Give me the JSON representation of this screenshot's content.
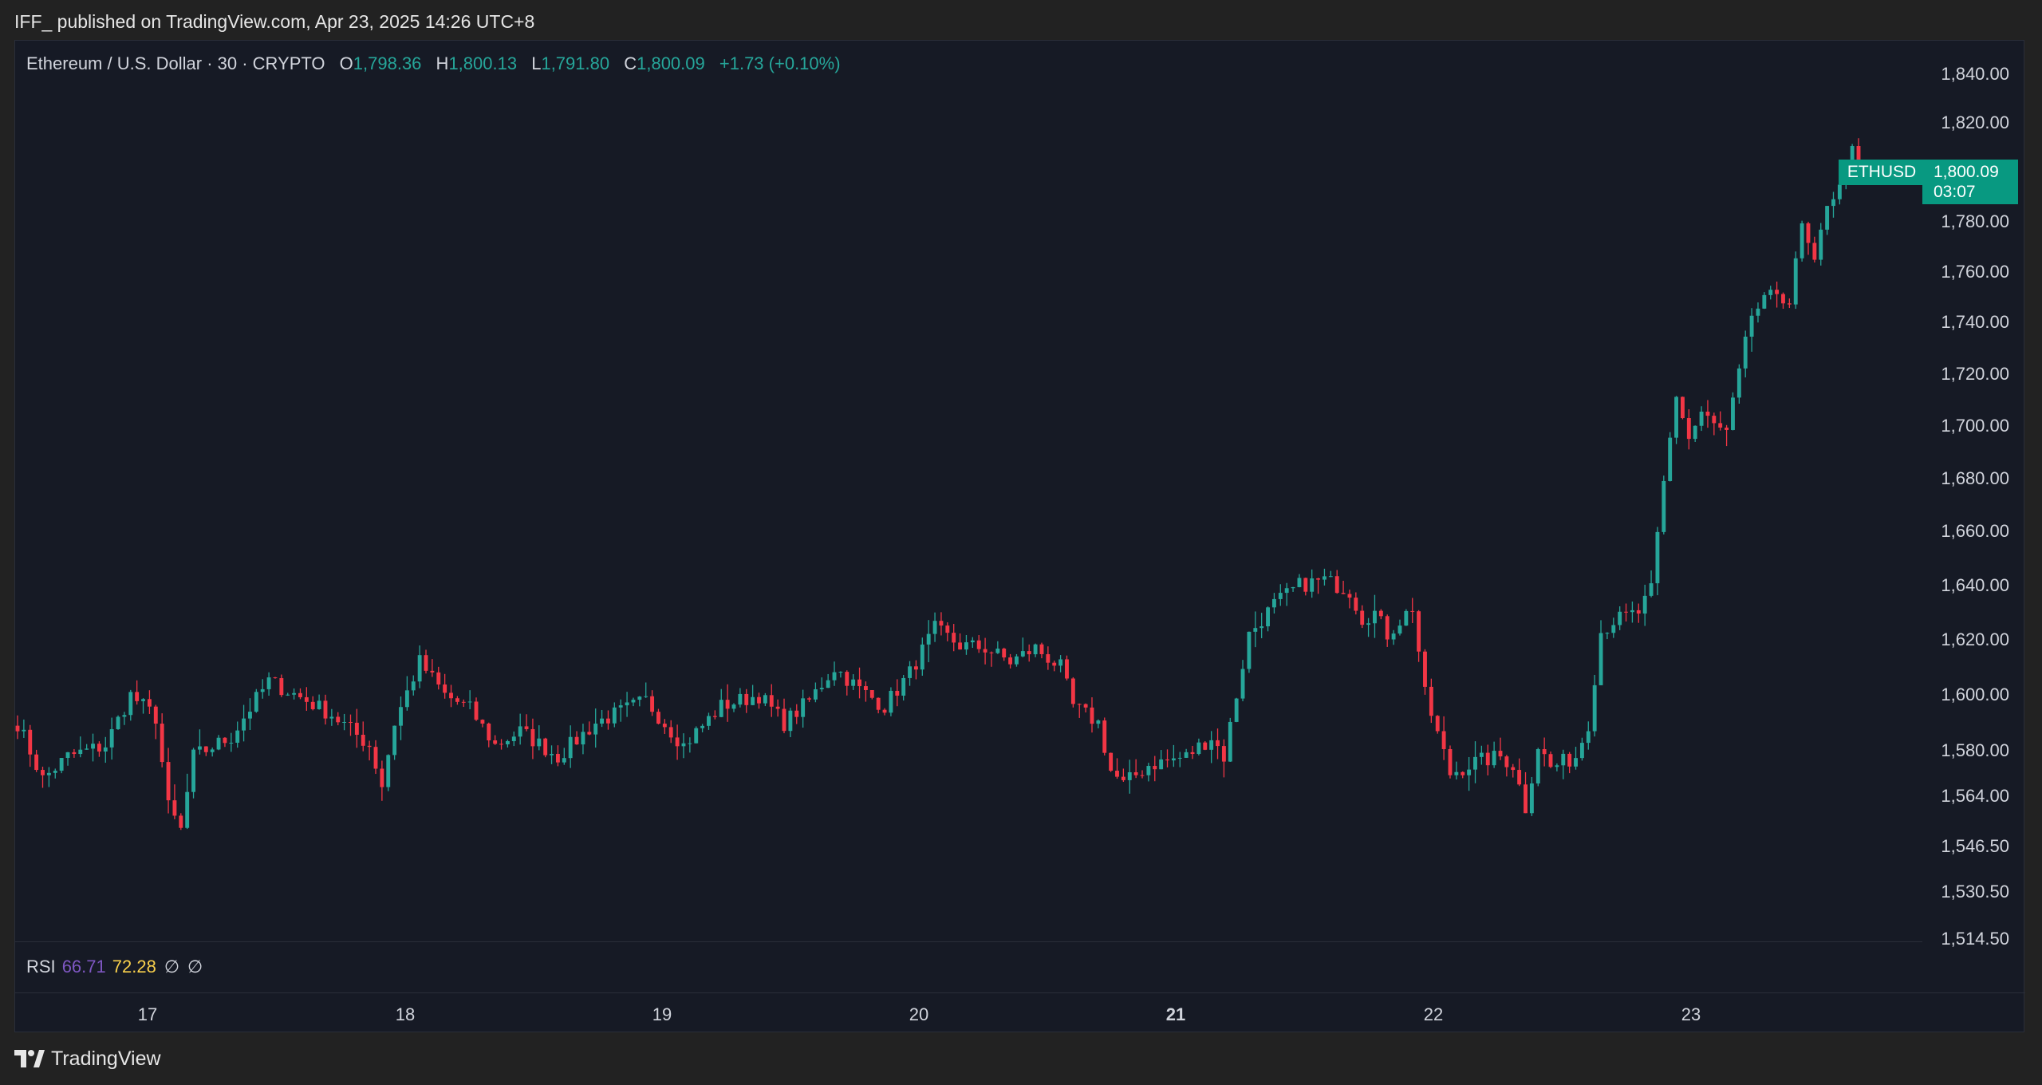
{
  "header": {
    "published_text": "IFF_ published on TradingView.com, Apr 23, 2025 14:26 UTC+8"
  },
  "legend": {
    "symbol": "Ethereum / U.S. Dollar · 30 · CRYPTO",
    "o_label": "O",
    "o_value": "1,798.36",
    "h_label": "H",
    "h_value": "1,800.13",
    "l_label": "L",
    "l_value": "1,791.80",
    "c_label": "C",
    "c_value": "1,800.09",
    "change": "+1.73 (+0.10%)"
  },
  "last_price": {
    "ticker": "ETHUSD",
    "price": "1,800.09",
    "countdown": "03:07"
  },
  "rsi": {
    "name": "RSI",
    "value1": "66.71",
    "value2": "72.28",
    "sym1": "∅",
    "sym2": "∅"
  },
  "footer": {
    "brand": "TradingView"
  },
  "colors": {
    "up": "#26a69a",
    "down": "#f23645",
    "background": "#161a25",
    "tag": "#089981"
  },
  "chart_data": {
    "type": "candlestick",
    "title": "Ethereum / U.S. Dollar · 30 · CRYPTO",
    "scale": "log",
    "ylim": [
      1514.5,
      1850
    ],
    "price_ticks": [
      "1,840.00",
      "1,820.00",
      "1,800.00",
      "1,780.00",
      "1,760.00",
      "1,740.00",
      "1,720.00",
      "1,700.00",
      "1,680.00",
      "1,660.00",
      "1,640.00",
      "1,620.00",
      "1,600.00",
      "1,580.00",
      "1,564.00",
      "1,546.50",
      "1,530.50",
      "1,514.50"
    ],
    "price_tick_values": [
      1840,
      1820,
      1800,
      1780,
      1760,
      1740,
      1720,
      1700,
      1680,
      1660,
      1640,
      1620,
      1600,
      1580,
      1564,
      1546.5,
      1530.5,
      1514.5
    ],
    "time_labels": [
      "17",
      "18",
      "19",
      "20",
      "21",
      "22",
      "23"
    ],
    "time_label_bold": [
      false,
      false,
      false,
      false,
      true,
      false,
      false
    ],
    "grid": false,
    "candle_interval": "30 minutes",
    "anchors": [
      [
        0,
        1590
      ],
      [
        4,
        1570
      ],
      [
        8,
        1578
      ],
      [
        14,
        1582
      ],
      [
        18,
        1600
      ],
      [
        22,
        1592
      ],
      [
        24,
        1560
      ],
      [
        26,
        1552
      ],
      [
        28,
        1578
      ],
      [
        34,
        1585
      ],
      [
        36,
        1592
      ],
      [
        40,
        1605
      ],
      [
        46,
        1598
      ],
      [
        50,
        1593
      ],
      [
        56,
        1582
      ],
      [
        58,
        1568
      ],
      [
        60,
        1590
      ],
      [
        64,
        1612
      ],
      [
        68,
        1600
      ],
      [
        72,
        1595
      ],
      [
        76,
        1582
      ],
      [
        80,
        1587
      ],
      [
        86,
        1578
      ],
      [
        92,
        1590
      ],
      [
        100,
        1598
      ],
      [
        106,
        1582
      ],
      [
        112,
        1596
      ],
      [
        118,
        1600
      ],
      [
        122,
        1590
      ],
      [
        126,
        1598
      ],
      [
        130,
        1610
      ],
      [
        134,
        1602
      ],
      [
        138,
        1596
      ],
      [
        142,
        1608
      ],
      [
        146,
        1624
      ],
      [
        150,
        1618
      ],
      [
        154,
        1617
      ],
      [
        158,
        1612
      ],
      [
        162,
        1617
      ],
      [
        166,
        1610
      ],
      [
        168,
        1596
      ],
      [
        172,
        1590
      ],
      [
        174,
        1573
      ],
      [
        176,
        1568
      ],
      [
        180,
        1575
      ],
      [
        186,
        1578
      ],
      [
        190,
        1585
      ],
      [
        192,
        1578
      ],
      [
        194,
        1600
      ],
      [
        196,
        1622
      ],
      [
        200,
        1633
      ],
      [
        204,
        1640
      ],
      [
        208,
        1642
      ],
      [
        212,
        1638
      ],
      [
        214,
        1628
      ],
      [
        216,
        1630
      ],
      [
        218,
        1622
      ],
      [
        222,
        1632
      ],
      [
        224,
        1600
      ],
      [
        228,
        1572
      ],
      [
        232,
        1576
      ],
      [
        236,
        1578
      ],
      [
        238,
        1575
      ],
      [
        240,
        1560
      ],
      [
        242,
        1582
      ],
      [
        244,
        1574
      ],
      [
        248,
        1578
      ],
      [
        250,
        1590
      ],
      [
        252,
        1623
      ],
      [
        254,
        1627
      ],
      [
        258,
        1630
      ],
      [
        260,
        1638
      ],
      [
        262,
        1678
      ],
      [
        264,
        1712
      ],
      [
        266,
        1695
      ],
      [
        268,
        1705
      ],
      [
        270,
        1700
      ],
      [
        272,
        1697
      ],
      [
        274,
        1720
      ],
      [
        276,
        1743
      ],
      [
        278,
        1748
      ],
      [
        280,
        1752
      ],
      [
        282,
        1748
      ],
      [
        284,
        1778
      ],
      [
        286,
        1762
      ],
      [
        288,
        1788
      ],
      [
        290,
        1793
      ],
      [
        292,
        1808
      ],
      [
        293,
        1800
      ]
    ],
    "last_value": 1800.09
  }
}
